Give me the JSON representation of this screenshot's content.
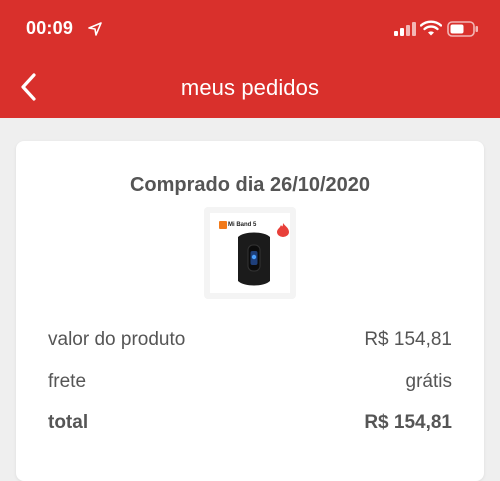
{
  "status_bar": {
    "time": "00:09"
  },
  "header": {
    "title": "meus pedidos"
  },
  "order": {
    "purchase_date": "Comprado dia 26/10/2020",
    "product_image_brand": "Mi Band 5",
    "rows": [
      {
        "label": "valor do produto",
        "value": "R$ 154,81"
      },
      {
        "label": "frete",
        "value": "grátis"
      },
      {
        "label": "total",
        "value": "R$ 154,81"
      }
    ]
  },
  "colors": {
    "brand_red": "#d9302c",
    "background": "#efefef"
  }
}
